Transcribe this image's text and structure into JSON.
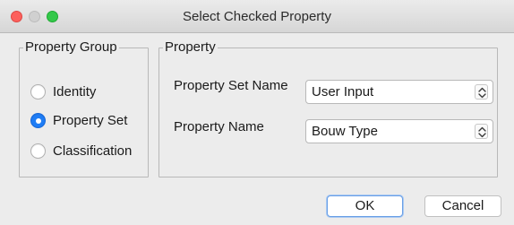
{
  "window": {
    "title": "Select Checked Property"
  },
  "property_group": {
    "legend": "Property Group",
    "options": [
      {
        "label": "Identity",
        "checked": false
      },
      {
        "label": "Property Set",
        "checked": true
      },
      {
        "label": "Classification",
        "checked": false
      }
    ]
  },
  "property": {
    "legend": "Property",
    "set_name_label": "Property Set Name",
    "set_name_value": "User Input",
    "name_label": "Property Name",
    "name_value": "Bouw Type"
  },
  "buttons": {
    "ok": "OK",
    "cancel": "Cancel"
  },
  "colors": {
    "accent": "#1f7df5",
    "close": "#fc605c",
    "zoom": "#34c84a"
  }
}
